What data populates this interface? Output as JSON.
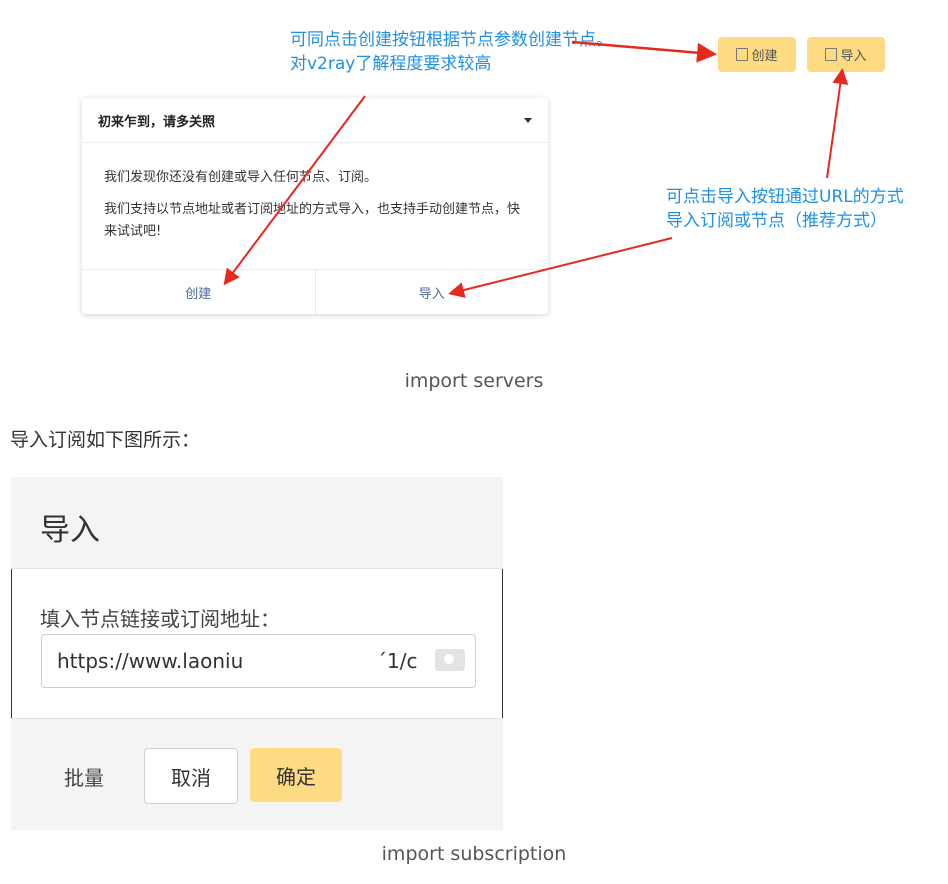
{
  "annotations": {
    "create_line1": "可同点击创建按钮根据节点参数创建节点。",
    "create_line2": "对v2ray了解程度要求较高",
    "import_line1": "可点击导入按钮通过URL的方式",
    "import_line2": "导入订阅或节点（推荐方式）"
  },
  "top_buttons": {
    "create": "创建",
    "import": "导入"
  },
  "card": {
    "title": "初来乍到，请多关照",
    "line1": "我们发现你还没有创建或导入任何节点、订阅。",
    "line2": "我们支持以节点地址或者订阅地址的方式导入，也支持手动创建节点，快来试试吧!",
    "footer_create": "创建",
    "footer_import": "导入"
  },
  "caption1": "import servers",
  "paragraph": "导入订阅如下图所示：",
  "modal": {
    "title": "导入",
    "field_label": "填入节点链接或订阅地址：",
    "field_value": "https://www.laoniu",
    "field_value_tail": "´1/c",
    "batch": "批量",
    "cancel": "取消",
    "ok": "确定"
  },
  "caption2": "import subscription",
  "colors": {
    "annotation_blue": "#1e90e8",
    "arrow_red": "#e8281e",
    "button_yellow": "#fddb82"
  }
}
